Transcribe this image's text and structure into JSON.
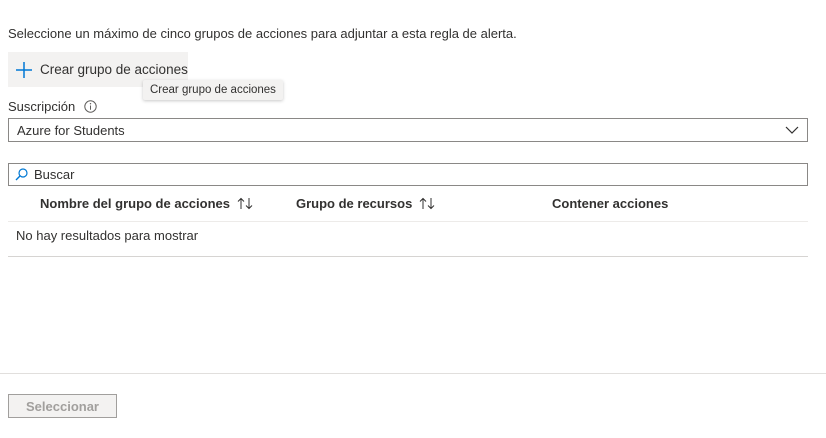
{
  "intro_text": "Seleccione un máximo de cinco grupos de acciones para adjuntar a esta regla de alerta.",
  "create_button": {
    "label": "Crear grupo de acciones",
    "icon": "plus-icon"
  },
  "tooltip": {
    "text": "Crear grupo de acciones"
  },
  "subscription": {
    "label": "Suscripción",
    "info_icon": "info-icon",
    "selected": "Azure for Students"
  },
  "search": {
    "placeholder": "Buscar",
    "value": ""
  },
  "table": {
    "columns": [
      {
        "label": "Nombre del grupo de acciones",
        "sortable": true
      },
      {
        "label": "Grupo de recursos",
        "sortable": true
      },
      {
        "label": "Contener acciones",
        "sortable": false
      }
    ],
    "empty_message": "No hay resultados para mostrar"
  },
  "footer": {
    "select_label": "Seleccionar",
    "select_enabled": false
  },
  "colors": {
    "accent": "#0078d4",
    "button_bg": "#f3f2f1",
    "text": "#323130",
    "disabled_text": "#a19f9d",
    "border": "#8a8886"
  }
}
